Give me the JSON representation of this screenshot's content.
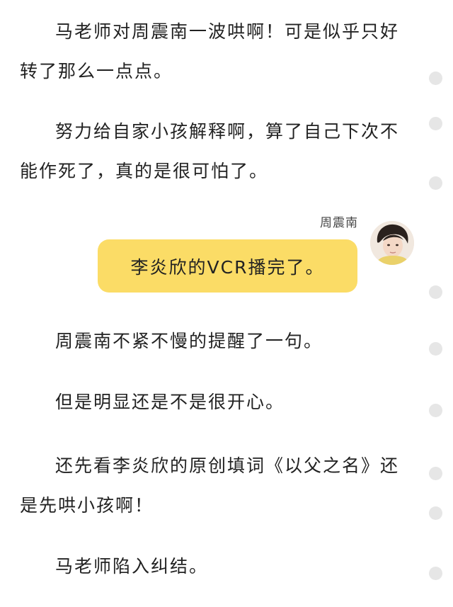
{
  "paragraphs": [
    "马老师对周震南一波哄啊！可是似乎只好转了那么一点点。",
    "努力给自家小孩解释啊，算了自己下次不能作死了，真的是很可怕了。",
    "周震南不紧不慢的提醒了一句。",
    "但是明显还是不是很开心。",
    "还先看李炎欣的原创填词《以父之名》还是先哄小孩啊！",
    "马老师陷入纠结。"
  ],
  "chat": {
    "sender_name": "周震南",
    "message": "李炎欣的VCR播完了。",
    "bubble_color": "#fbdc66"
  },
  "side_dots_count": 9
}
